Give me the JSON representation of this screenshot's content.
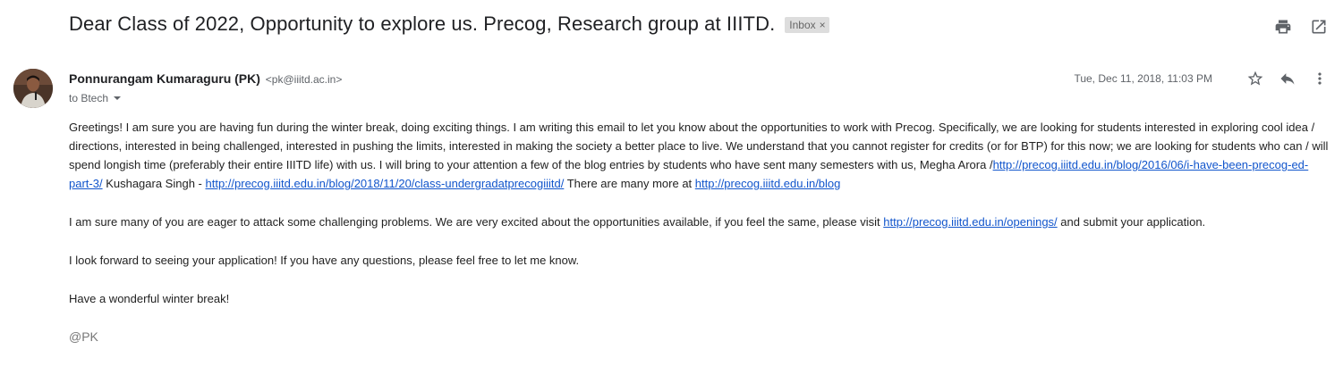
{
  "subject": {
    "title": "Dear Class of 2022, Opportunity to explore us. Precog, Research group at IIITD.",
    "label": "Inbox",
    "label_remove": "×"
  },
  "toolbar_icons": [
    "print-icon",
    "open-in-new-window-icon"
  ],
  "sender": {
    "name": "Ponnurangam Kumaraguru (PK)",
    "email": "<pk@iiitd.ac.in>",
    "to": "to Btech"
  },
  "meta": {
    "timestamp": "Tue, Dec 11, 2018, 11:03 PM",
    "icons": [
      "star-icon",
      "reply-icon",
      "more-vert-icon"
    ]
  },
  "body": {
    "p1_text": "Greetings! I am sure you are having fun during the winter break, doing exciting things. I am writing this email to let you know about the opportunities to work with Precog. Specifically, we are looking for students interested in exploring cool idea / directions, interested in being challenged, interested in pushing the limits, interested in making the society a better place to live. We understand that you cannot register for credits (or for BTP) for this now; we are looking for students who can / will spend longish time (preferably their entire IIITD life) with us. I will bring to your attention a few of the blog entries by students who have sent many semesters with us, Megha Arora /",
    "link1": "http://precog.iiitd.edu.in/blog/2016/06/i-have-been-precog-ed-part-3/",
    "p1_mid": " Kushagara Singh - ",
    "link2": "http://precog.iiitd.edu.in/blog/2018/11/20/class-undergradatprecogiiitd/",
    "p1_end": " There are many more at ",
    "link3": "http://precog.iiitd.edu.in/blog",
    "p2_text": "I am sure many of you are eager to attack some challenging problems. We are very excited about the opportunities available, if you feel the same, please visit ",
    "link4": "http://precog.iiitd.edu.in/openings/",
    "p2_end": " and submit your application.",
    "p3": "I look forward to seeing your application! If you have any questions, please feel free to let me know.",
    "p4": "Have a wonderful winter break!",
    "signature": "@PK"
  }
}
